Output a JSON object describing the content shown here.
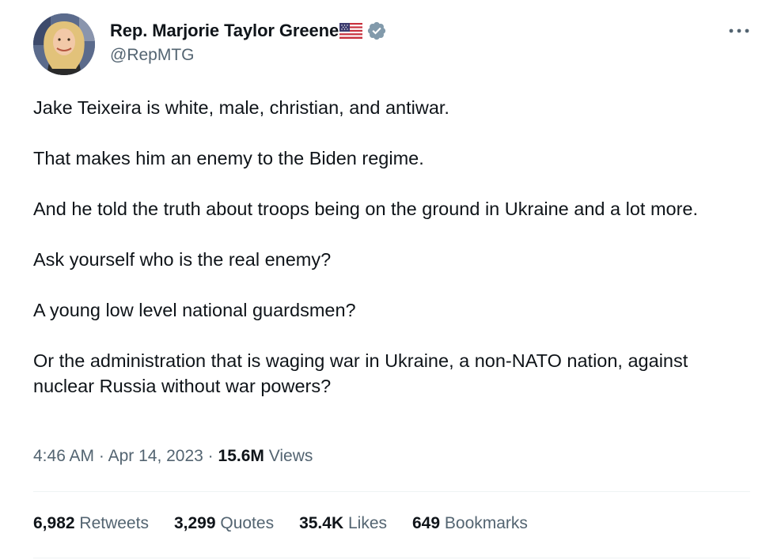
{
  "author": {
    "display_name": "Rep. Marjorie Taylor Greene",
    "handle": "@RepMTG",
    "flag_icon": "us-flag-emoji",
    "verified_icon": "verified-badge-gray",
    "avatar_icon": "profile-photo"
  },
  "more_icon": "ellipsis-icon",
  "tweet": {
    "paragraphs": [
      "Jake Teixeira is white, male, christian, and antiwar.",
      "That makes him an enemy to the Biden regime.",
      "And he told the truth about troops being on the ground in Ukraine and a lot more.",
      "Ask yourself who is the real enemy?",
      "A young low level national guardsmen?",
      "Or the administration that is waging war in Ukraine, a non-NATO nation, against nuclear Russia without war powers?"
    ]
  },
  "meta": {
    "time": "4:46 AM",
    "separator": " · ",
    "date": "Apr 14, 2023",
    "views_count": "15.6M",
    "views_label": "Views"
  },
  "stats": {
    "retweets": {
      "count": "6,982",
      "label": "Retweets"
    },
    "quotes": {
      "count": "3,299",
      "label": "Quotes"
    },
    "likes": {
      "count": "35.4K",
      "label": "Likes"
    },
    "bookmarks": {
      "count": "649",
      "label": "Bookmarks"
    }
  },
  "colors": {
    "text_primary": "#0f1419",
    "text_secondary": "#536471",
    "divider": "#eff3f4",
    "verified_badge": "#829aab"
  }
}
